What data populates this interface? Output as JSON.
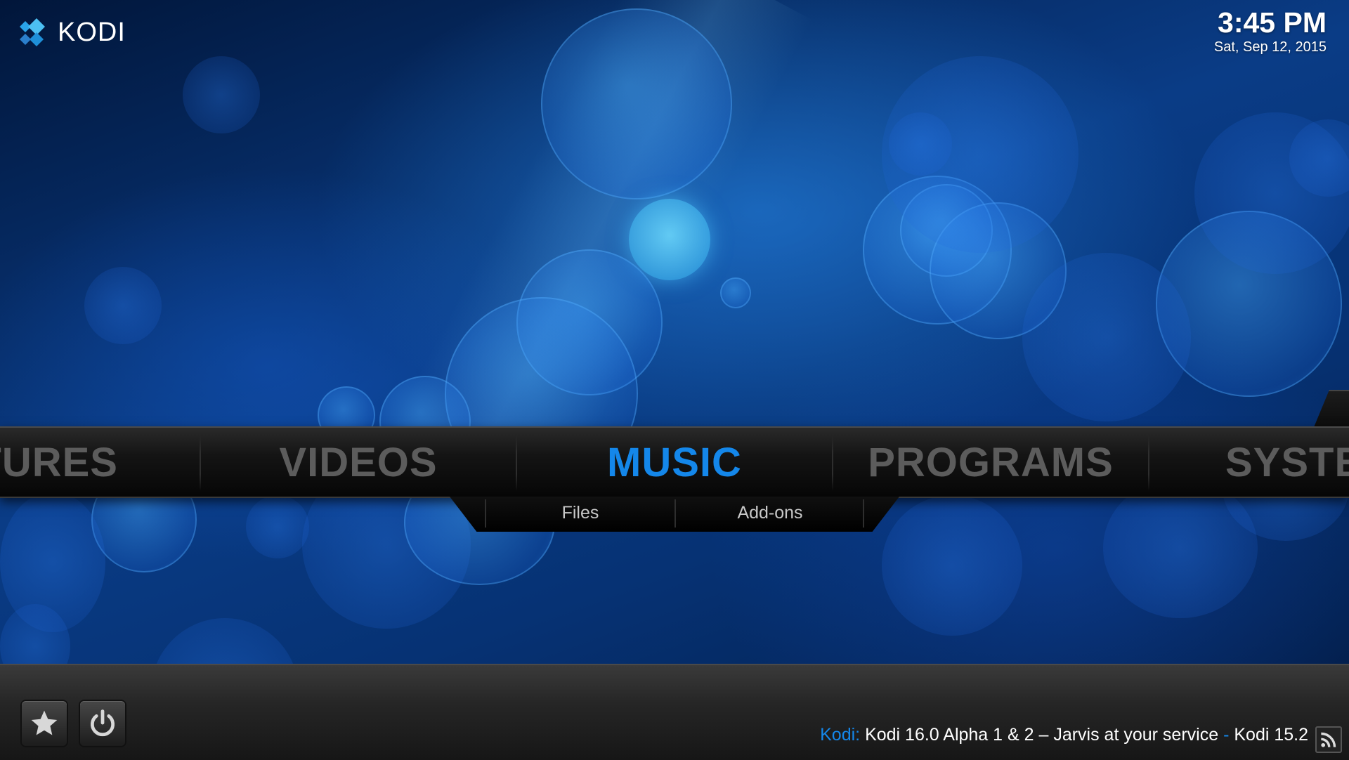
{
  "app": {
    "logo_text": "KODI"
  },
  "clock": {
    "time": "3:45 PM",
    "date": "Sat, Sep 12, 2015"
  },
  "main_menu": {
    "items": [
      {
        "label": "PICTURES",
        "visible_label": "CTURES"
      },
      {
        "label": "VIDEOS"
      },
      {
        "label": "MUSIC",
        "active": true
      },
      {
        "label": "PROGRAMS"
      },
      {
        "label": "SYSTEM",
        "visible_label": "SYSTE"
      }
    ]
  },
  "submenu": {
    "items": [
      {
        "label": "Files"
      },
      {
        "label": "Add-ons"
      }
    ]
  },
  "footer": {
    "favourites_icon": "star-icon",
    "power_icon": "power-icon",
    "ticker_source": "Kodi:",
    "ticker_headline": "Kodi 16.0 Alpha 1 & 2 – Jarvis at your service",
    "ticker_separator": "-",
    "ticker_next": "Kodi 15.2",
    "rss_icon": "rss-icon"
  },
  "colors": {
    "accent": "#1487ea",
    "menu_inactive": "#5c5c5c",
    "bar": "#0b0b0b"
  }
}
